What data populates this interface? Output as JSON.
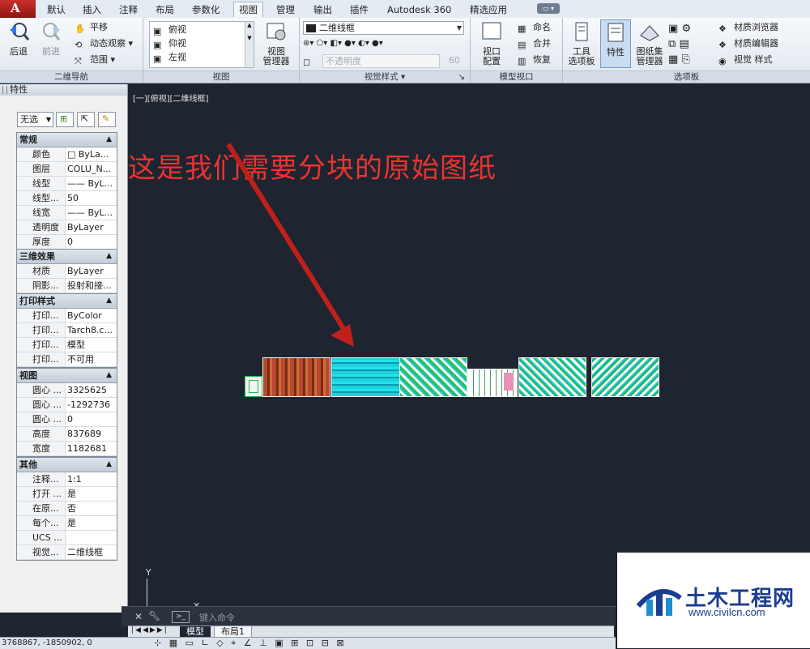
{
  "menu": {
    "tabs": [
      "默认",
      "插入",
      "注释",
      "布局",
      "参数化",
      "视图",
      "管理",
      "输出",
      "插件",
      "Autodesk 360",
      "精选应用"
    ],
    "active": "视图"
  },
  "ribbon": {
    "nav2d": {
      "back": "后退",
      "forward": "前进",
      "pan": "平移",
      "orbit": "动态观察",
      "extents": "范围",
      "title": "二维导航"
    },
    "views": {
      "top": "俯视",
      "bottom": "仰视",
      "left": "左视",
      "manager": "视图\n管理器",
      "title": "视图"
    },
    "visual": {
      "style": "二维线框",
      "opacity_label": "不透明度",
      "opacity_value": "60",
      "title": "视觉样式"
    },
    "viewports": {
      "config": "视口\n配置",
      "name": "命名",
      "join": "合并",
      "restore": "恢复",
      "title": "模型视口"
    },
    "palettes": {
      "tool": "工具\n选项板",
      "properties": "特性",
      "sheetset": "图纸集\n管理器",
      "materials_browser": "材质浏览器",
      "materials_editor": "材质编辑器",
      "visual_styles": "视觉 样式",
      "title": "选项板"
    }
  },
  "properties": {
    "title": "特性",
    "selection": "无选",
    "sections": [
      {
        "name": "常规",
        "rows": [
          [
            "颜色",
            "□ ByLa..."
          ],
          [
            "图层",
            "COLU_N..."
          ],
          [
            "线型",
            "—— ByL..."
          ],
          [
            "线型...",
            "50"
          ],
          [
            "线宽",
            "—— ByL..."
          ],
          [
            "透明度",
            "ByLayer"
          ],
          [
            "厚度",
            "0"
          ]
        ]
      },
      {
        "name": "三维效果",
        "rows": [
          [
            "材质",
            "ByLayer"
          ],
          [
            "阴影...",
            "投射和接..."
          ]
        ]
      },
      {
        "name": "打印样式",
        "rows": [
          [
            "打印...",
            "ByColor"
          ],
          [
            "打印...",
            "Tarch8.c..."
          ],
          [
            "打印...",
            "模型"
          ],
          [
            "打印...",
            "不可用"
          ]
        ]
      },
      {
        "name": "视图",
        "rows": [
          [
            "圆心 ...",
            "3325625"
          ],
          [
            "圆心 ...",
            "-1292736"
          ],
          [
            "圆心 ...",
            "0"
          ],
          [
            "高度",
            "837689"
          ],
          [
            "宽度",
            "1182681"
          ]
        ]
      },
      {
        "name": "其他",
        "rows": [
          [
            "注释...",
            "1:1"
          ],
          [
            "打开 ...",
            "是"
          ],
          [
            "在原...",
            "否"
          ],
          [
            "每个...",
            "是"
          ],
          [
            "UCS ...",
            ""
          ],
          [
            "视觉...",
            "二维线框"
          ]
        ]
      }
    ]
  },
  "viewport": {
    "label": "[一][俯视][二维线框]",
    "annotation": "这是我们需要分块的原始图纸",
    "ucs_y": "Y"
  },
  "command": {
    "placeholder": "键入命令"
  },
  "layout_tabs": [
    "模型",
    "布局1"
  ],
  "status": {
    "coords": "3768867, -1850902, 0"
  },
  "watermark": {
    "title": "土木工程网",
    "url": "www.civilcn.com"
  },
  "colors": {
    "annotation": "#e83530",
    "arrow": "#c0201c",
    "canvas": "#1e2430",
    "brand": "#1b3c8f"
  }
}
